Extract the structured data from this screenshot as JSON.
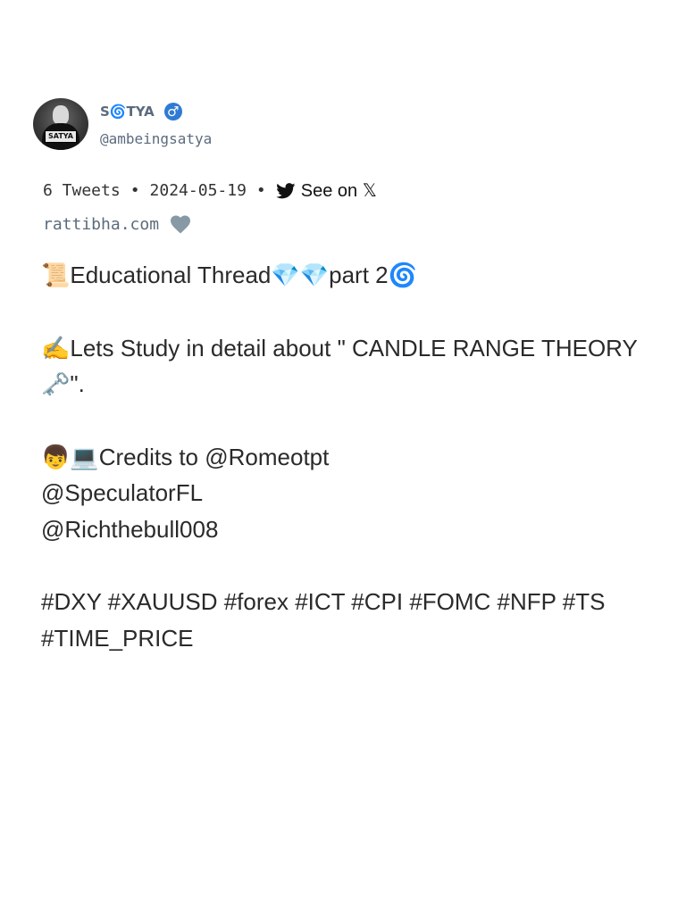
{
  "author": {
    "display_name": "S🌀TYA",
    "gender_symbol": "♂",
    "handle": "@ambeingsatya",
    "avatar_sign": "SATYA",
    "avatar_icon": "masked-person-avatar"
  },
  "meta": {
    "tweet_count": "6 Tweets",
    "separator": "•",
    "date": "2024-05-19",
    "see_on_label": "See on 𝕏",
    "see_on_icon": "twitter-bird-icon"
  },
  "source": {
    "site": "rattibha.com",
    "heart_icon": "heart-icon",
    "heart_color": "#8899a6"
  },
  "thread": {
    "line1": "📜Educational Thread💎💎part 2🌀",
    "line2": "✍️Lets Study in detail about \"  CANDLE RANGE THEORY 🗝️\".",
    "line3": "👦💻Credits to @Romeotpt",
    "line4": "@SpeculatorFL",
    "line5": "@Richthebull008",
    "line6": "#DXY #XAUUSD #forex #ICT #CPI #FOMC #NFP #TS #TIME_PRICE"
  },
  "colors": {
    "muted_text": "#5b6b7d",
    "badge_blue": "#2f7bd3",
    "body_text": "#2a2a2a"
  }
}
